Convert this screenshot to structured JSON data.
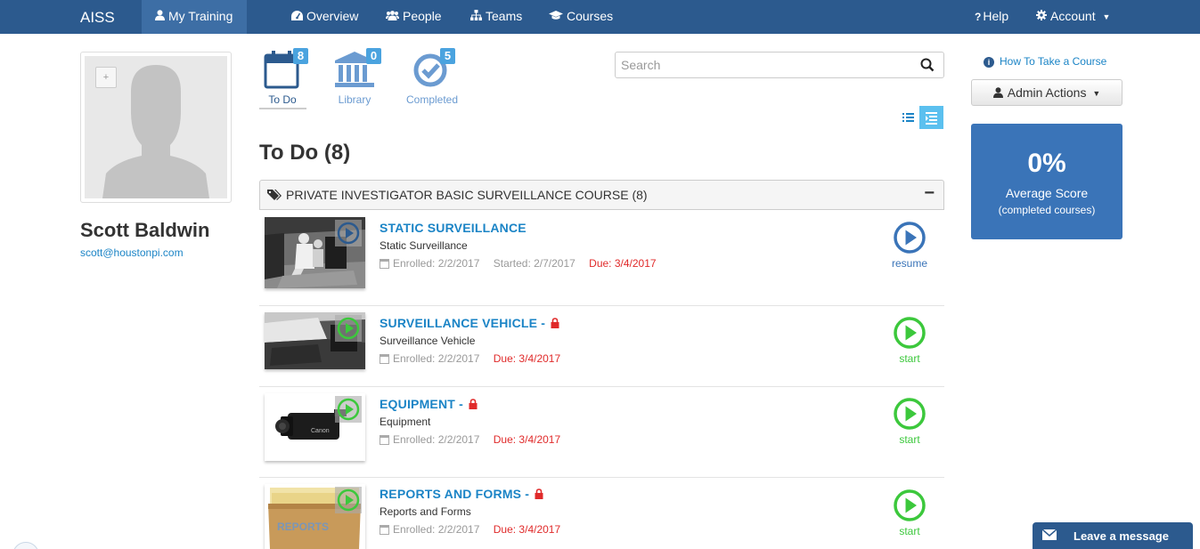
{
  "nav": {
    "brand": "AISS",
    "items": [
      {
        "label": "My Training",
        "icon": "user-icon"
      },
      {
        "label": "Overview",
        "icon": "dashboard-icon"
      },
      {
        "label": "People",
        "icon": "users-icon"
      },
      {
        "label": "Teams",
        "icon": "sitemap-icon"
      },
      {
        "label": "Courses",
        "icon": "graduation-cap-icon"
      }
    ],
    "help": "Help",
    "account": "Account"
  },
  "profile": {
    "plus": "+",
    "name": "Scott Baldwin",
    "email": "scott@houstonpi.com"
  },
  "tabs": [
    {
      "label": "To Do",
      "count": "8",
      "icon": "calendar-icon"
    },
    {
      "label": "Library",
      "count": "0",
      "icon": "bank-icon"
    },
    {
      "label": "Completed",
      "count": "5",
      "icon": "check-circle-icon"
    }
  ],
  "search": {
    "placeholder": "Search",
    "value": ""
  },
  "page_title": "To Do (8)",
  "course_group": {
    "title": "PRIVATE INVESTIGATOR BASIC SURVEILLANCE COURSE (8)",
    "collapse": "−"
  },
  "items": [
    {
      "title": "STATIC SURVEILLANCE",
      "locked": false,
      "subtitle": "Static Surveillance",
      "enrolled": "Enrolled: 2/2/2017",
      "started": "Started: 2/7/2017",
      "due": "Due: 3/4/2017",
      "action": "resume"
    },
    {
      "title": "SURVEILLANCE VEHICLE -",
      "locked": true,
      "subtitle": "Surveillance Vehicle",
      "enrolled": "Enrolled: 2/2/2017",
      "started": "",
      "due": "Due: 3/4/2017",
      "action": "start"
    },
    {
      "title": "EQUIPMENT -",
      "locked": true,
      "subtitle": "Equipment",
      "enrolled": "Enrolled: 2/2/2017",
      "started": "",
      "due": "Due: 3/4/2017",
      "action": "start"
    },
    {
      "title": "REPORTS AND FORMS -",
      "locked": true,
      "subtitle": "Reports and Forms",
      "enrolled": "Enrolled: 2/2/2017",
      "started": "",
      "due": "Due: 3/4/2017",
      "action": "start"
    }
  ],
  "thumb_text": {
    "reports": "REPORTS",
    "camera_brand": "Canon"
  },
  "sidebar": {
    "howto": "How To Take a Course",
    "admin": "Admin Actions",
    "score": "0%",
    "score_label": "Average Score",
    "score_sub": "(completed courses)"
  },
  "chat": {
    "label": "Leave a message"
  },
  "colors": {
    "nav": "#2c5a8e",
    "link": "#1b84c6",
    "due": "#e02a2a",
    "start": "#3cc83c",
    "resume": "#3a74b8",
    "score_bg": "#3a74b8"
  }
}
